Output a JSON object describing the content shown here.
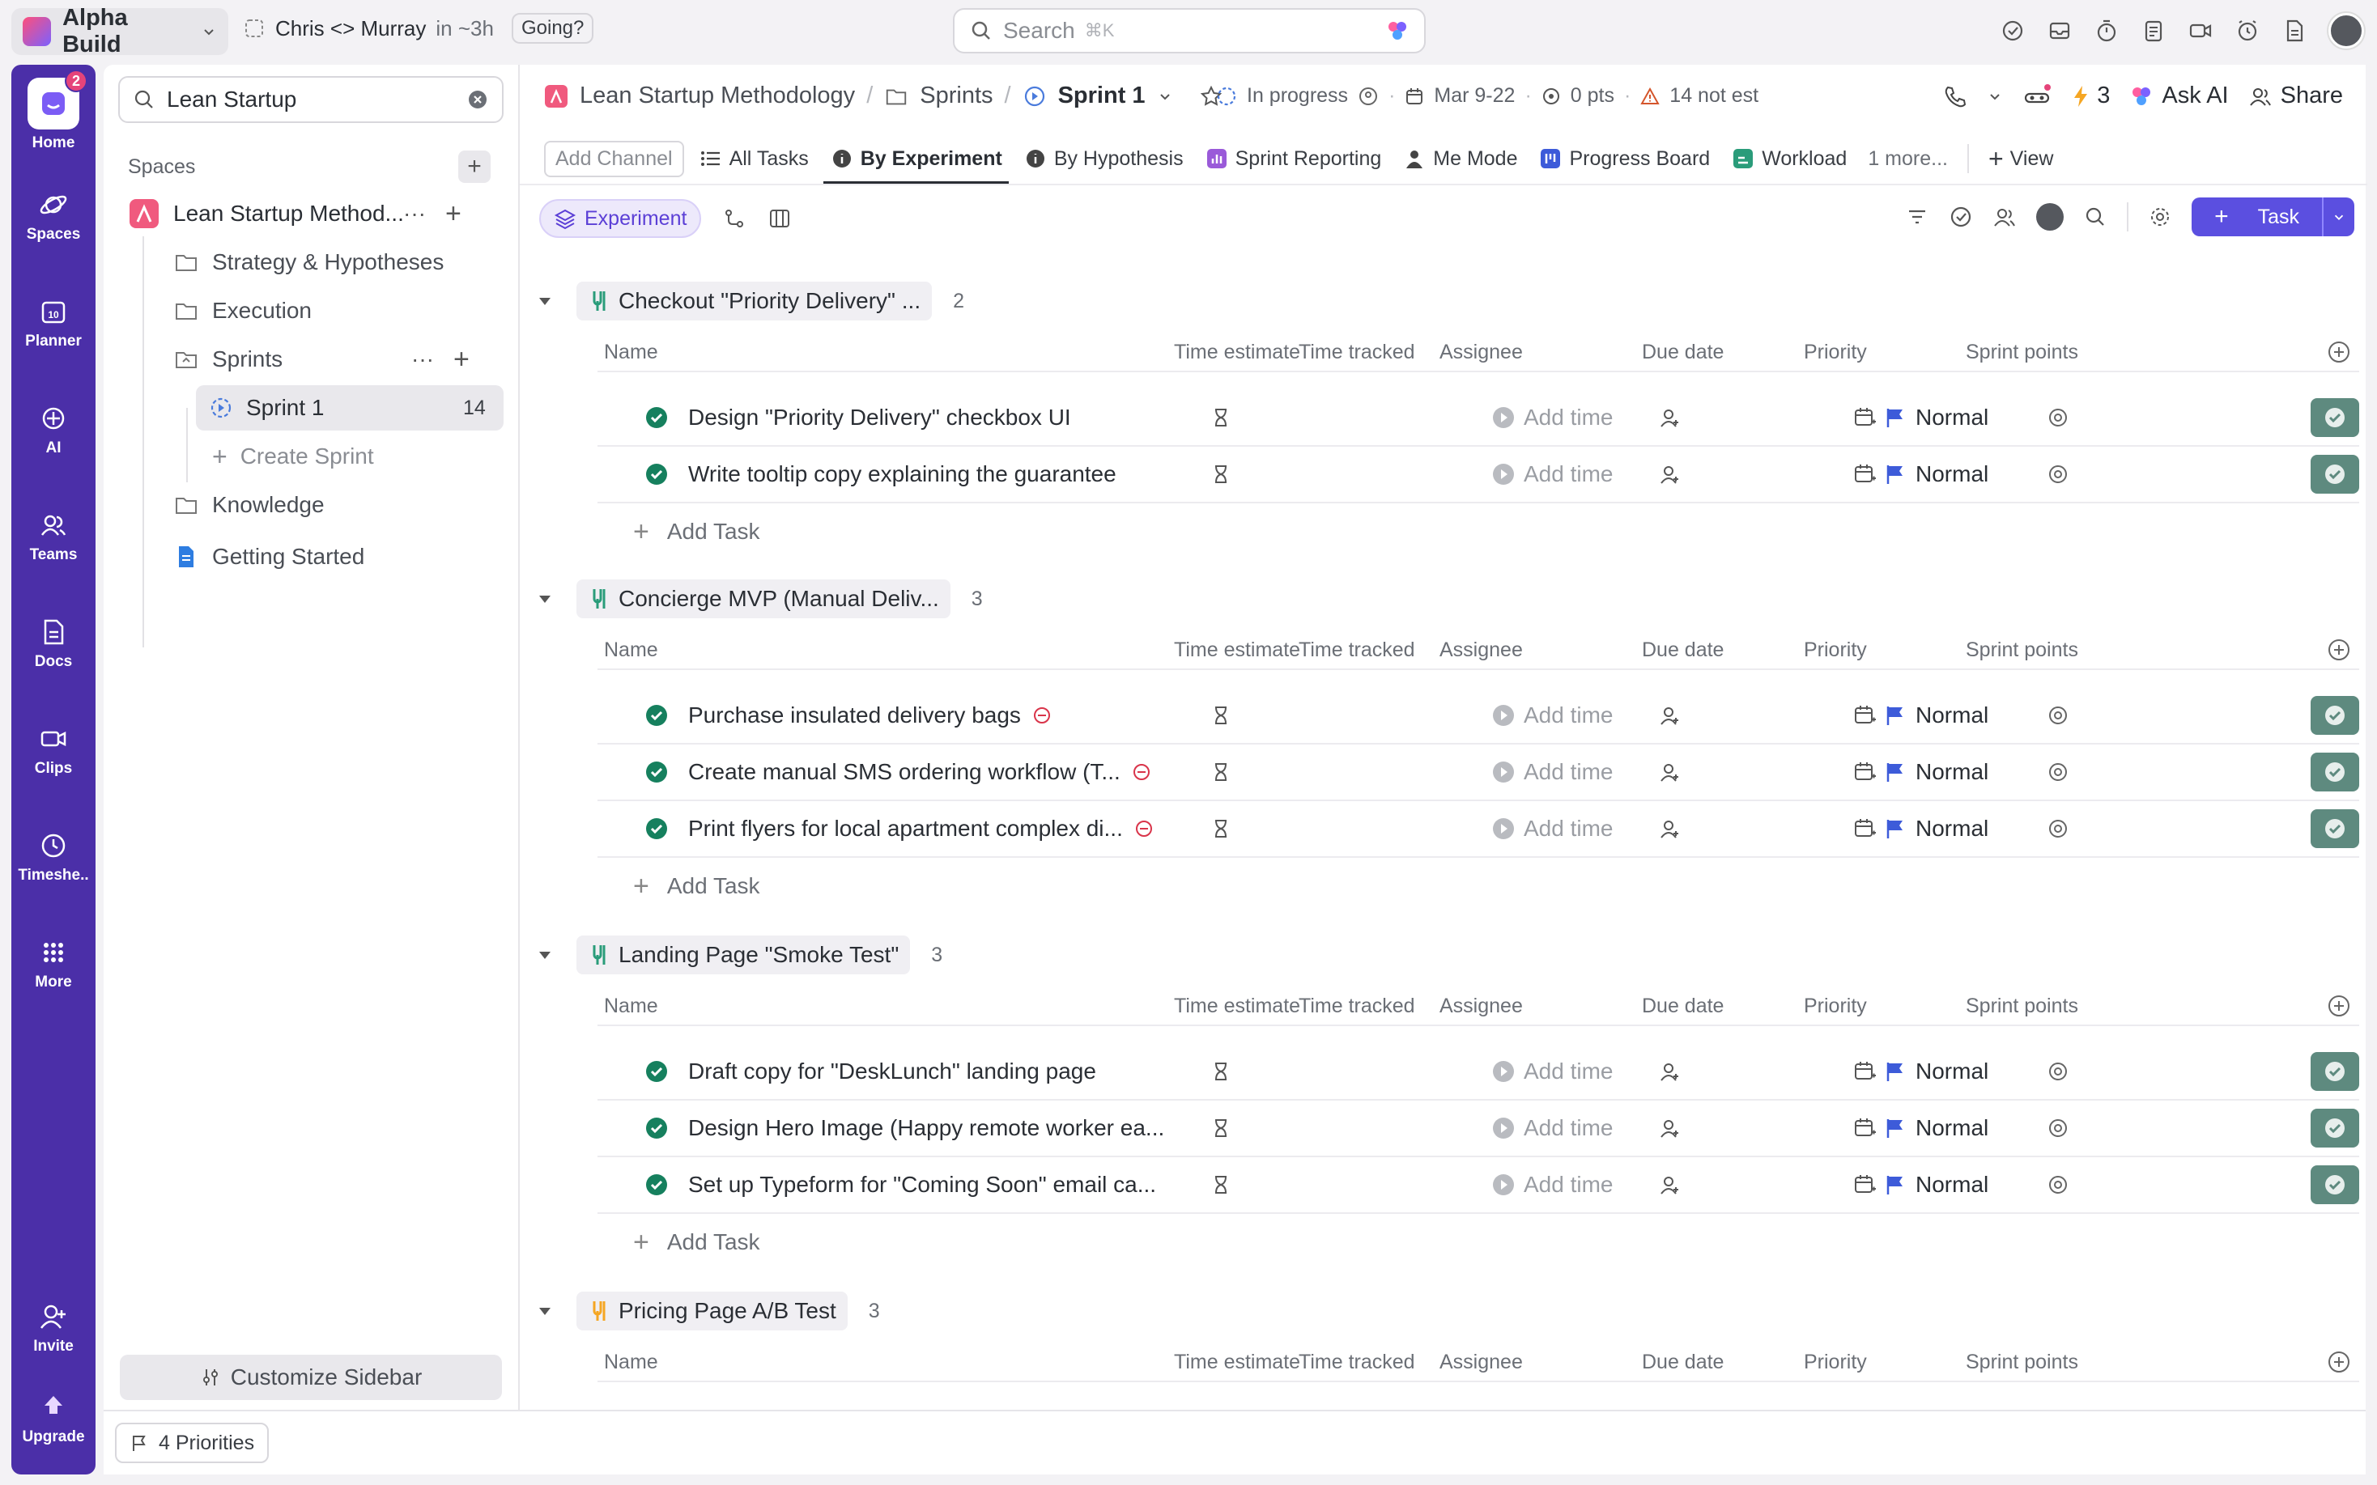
{
  "workspace": {
    "name": "Alpha Build"
  },
  "meeting": {
    "title": "Chris <> Murray",
    "time": "in ~3h",
    "going_label": "Going?"
  },
  "search": {
    "placeholder": "Search",
    "shortcut": "⌘K"
  },
  "rail": {
    "home_badge": "2",
    "items": [
      {
        "label": "Home"
      },
      {
        "label": "Spaces"
      },
      {
        "label": "Planner"
      },
      {
        "label": "AI"
      },
      {
        "label": "Teams"
      },
      {
        "label": "Docs"
      },
      {
        "label": "Clips"
      },
      {
        "label": "Timeshe.."
      },
      {
        "label": "More"
      },
      {
        "label": "Invite"
      },
      {
        "label": "Upgrade"
      }
    ]
  },
  "sidebar": {
    "search_value": "Lean Startup",
    "spaces_heading": "Spaces",
    "space_name": "Lean Startup Method...",
    "folders": [
      "Strategy & Hypotheses",
      "Execution",
      "Sprints"
    ],
    "sprint_item": {
      "label": "Sprint 1",
      "count": "14"
    },
    "create_sprint": "Create Sprint",
    "knowledge": "Knowledge",
    "getting_started": "Getting Started",
    "customize": "Customize Sidebar"
  },
  "header": {
    "breadcrumb": [
      "Lean Startup Methodology",
      "Sprints",
      "Sprint 1"
    ],
    "status": "In progress",
    "dates": "Mar 9-22",
    "points": "0 pts",
    "not_est": "14 not est",
    "automations_count": "3",
    "ask_ai": "Ask AI",
    "share": "Share"
  },
  "tabs": {
    "add_channel": "Add Channel",
    "items": [
      "All Tasks",
      "By Experiment",
      "By Hypothesis",
      "Sprint Reporting",
      "Me Mode",
      "Progress Board",
      "Workload"
    ],
    "more": "1 more...",
    "view": "View"
  },
  "viewbar": {
    "group_chip": "Experiment",
    "task_button": "Task"
  },
  "columns": {
    "name": "Name",
    "time_estimate": "Time estimate",
    "time_tracked": "Time tracked",
    "assignee": "Assignee",
    "due_date": "Due date",
    "priority": "Priority",
    "sprint_points": "Sprint points"
  },
  "add_time_label": "Add time",
  "add_task_label": "Add Task",
  "groups": [
    {
      "title": "Checkout \"Priority Delivery\" ...",
      "count": "2",
      "tasks": [
        {
          "name": "Design \"Priority Delivery\" checkbox UI",
          "priority": "Normal",
          "blocked": false
        },
        {
          "name": "Write tooltip copy explaining the guarantee",
          "priority": "Normal",
          "blocked": false
        }
      ]
    },
    {
      "title": "Concierge MVP (Manual Deliv...",
      "count": "3",
      "tasks": [
        {
          "name": "Purchase insulated delivery bags",
          "priority": "Normal",
          "blocked": true
        },
        {
          "name": "Create manual SMS ordering workflow (T...",
          "priority": "Normal",
          "blocked": true
        },
        {
          "name": "Print flyers for local apartment complex di...",
          "priority": "Normal",
          "blocked": true
        }
      ]
    },
    {
      "title": "Landing Page \"Smoke Test\"",
      "count": "3",
      "tasks": [
        {
          "name": "Draft copy for \"DeskLunch\" landing page",
          "priority": "Normal",
          "blocked": false
        },
        {
          "name": "Design Hero Image (Happy remote worker ea...",
          "priority": "Normal",
          "blocked": false
        },
        {
          "name": "Set up Typeform for \"Coming Soon\" email ca...",
          "priority": "Normal",
          "blocked": false
        }
      ]
    },
    {
      "title": "Pricing Page A/B Test",
      "count": "3",
      "tasks": []
    }
  ],
  "footer": {
    "priorities": "4 Priorities"
  },
  "colors": {
    "rail": "#4b2fa8",
    "accent": "#5b4fe0",
    "done_green": "#16805e",
    "flag": "#3d5bd9",
    "blocked": "#d9344a"
  }
}
